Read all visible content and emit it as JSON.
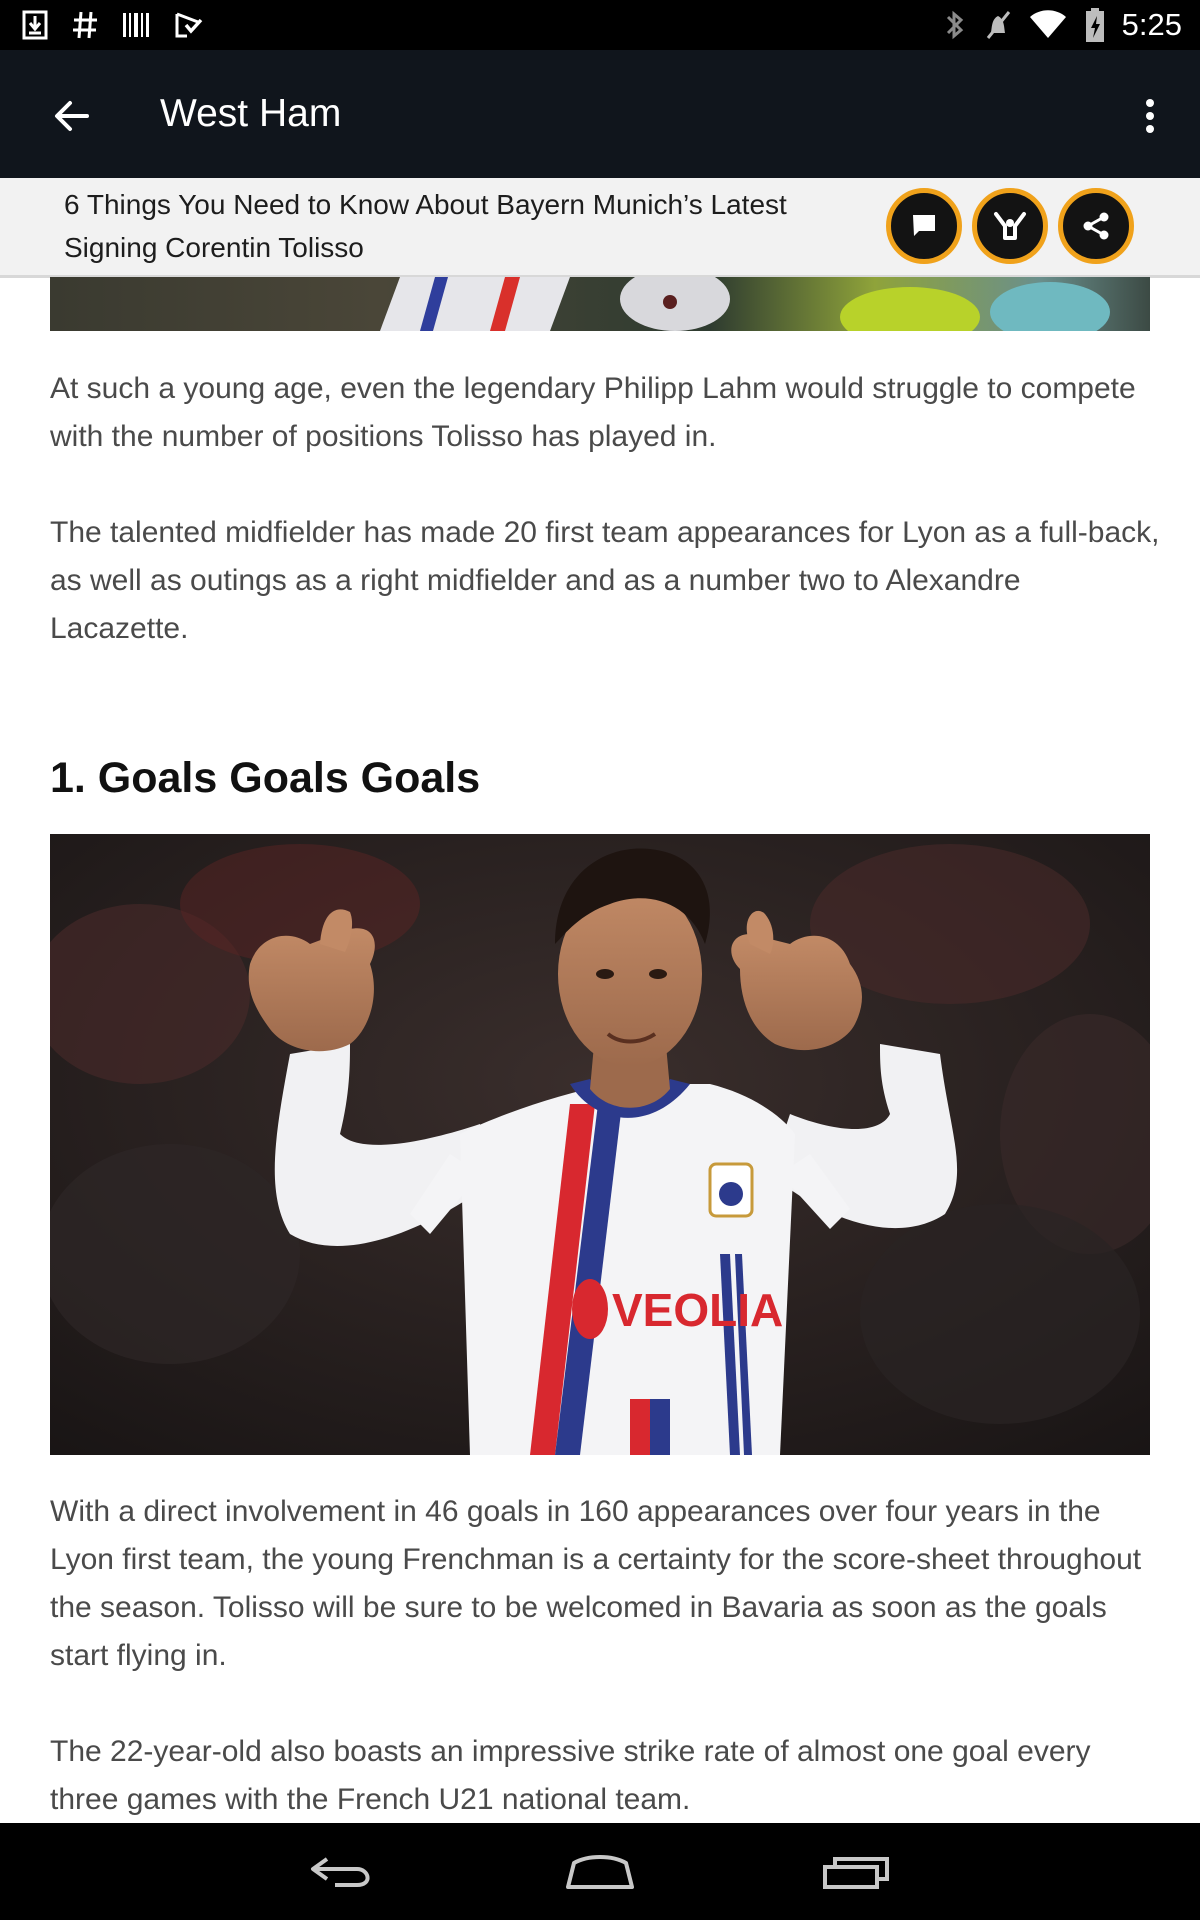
{
  "status_bar": {
    "time": "5:25",
    "left_icons": [
      "download-icon",
      "hash-icon",
      "barcode-icon",
      "play-store-icon"
    ],
    "right_icons": [
      "bluetooth-icon",
      "mute-icon",
      "wifi-icon",
      "battery-charging-icon"
    ]
  },
  "app_bar": {
    "title": "West Ham",
    "back_icon": "arrow-left-icon",
    "menu_icon": "more-vert-icon"
  },
  "article_header": {
    "title": "6 Things You Need to Know About Bayern Munich’s Latest Signing Corentin Tolisso",
    "actions": [
      "comment-icon",
      "cheer-icon",
      "share-icon"
    ],
    "accent_color": "#f0a21b"
  },
  "article": {
    "paragraph_1": "At such a young age, even the legendary Philipp Lahm would struggle to compete with the number of positions Tolisso has played in.",
    "paragraph_2": "The talented midfielder has made 20 first team appearances for Lyon as a full-back, as well as outings as a right midfielder and as a number two to Alexandre Lacazette.",
    "section_heading": "1. Goals Goals Goals",
    "photo_shirt_text": "VEOLIA",
    "paragraph_3": "With a direct involvement in 46 goals in 160 appearances over four years in the Lyon first team, the young Frenchman is a certainty for the score-sheet throughout the season. Tolisso will be sure to be welcomed in Bavaria as soon as the goals start flying in.",
    "paragraph_4": "The 22-year-old also boasts an impressive strike rate of almost one goal every three games with the French U21 national team."
  },
  "nav_bar": {
    "buttons": [
      "back-nav-icon",
      "home-nav-icon",
      "recents-nav-icon"
    ]
  }
}
